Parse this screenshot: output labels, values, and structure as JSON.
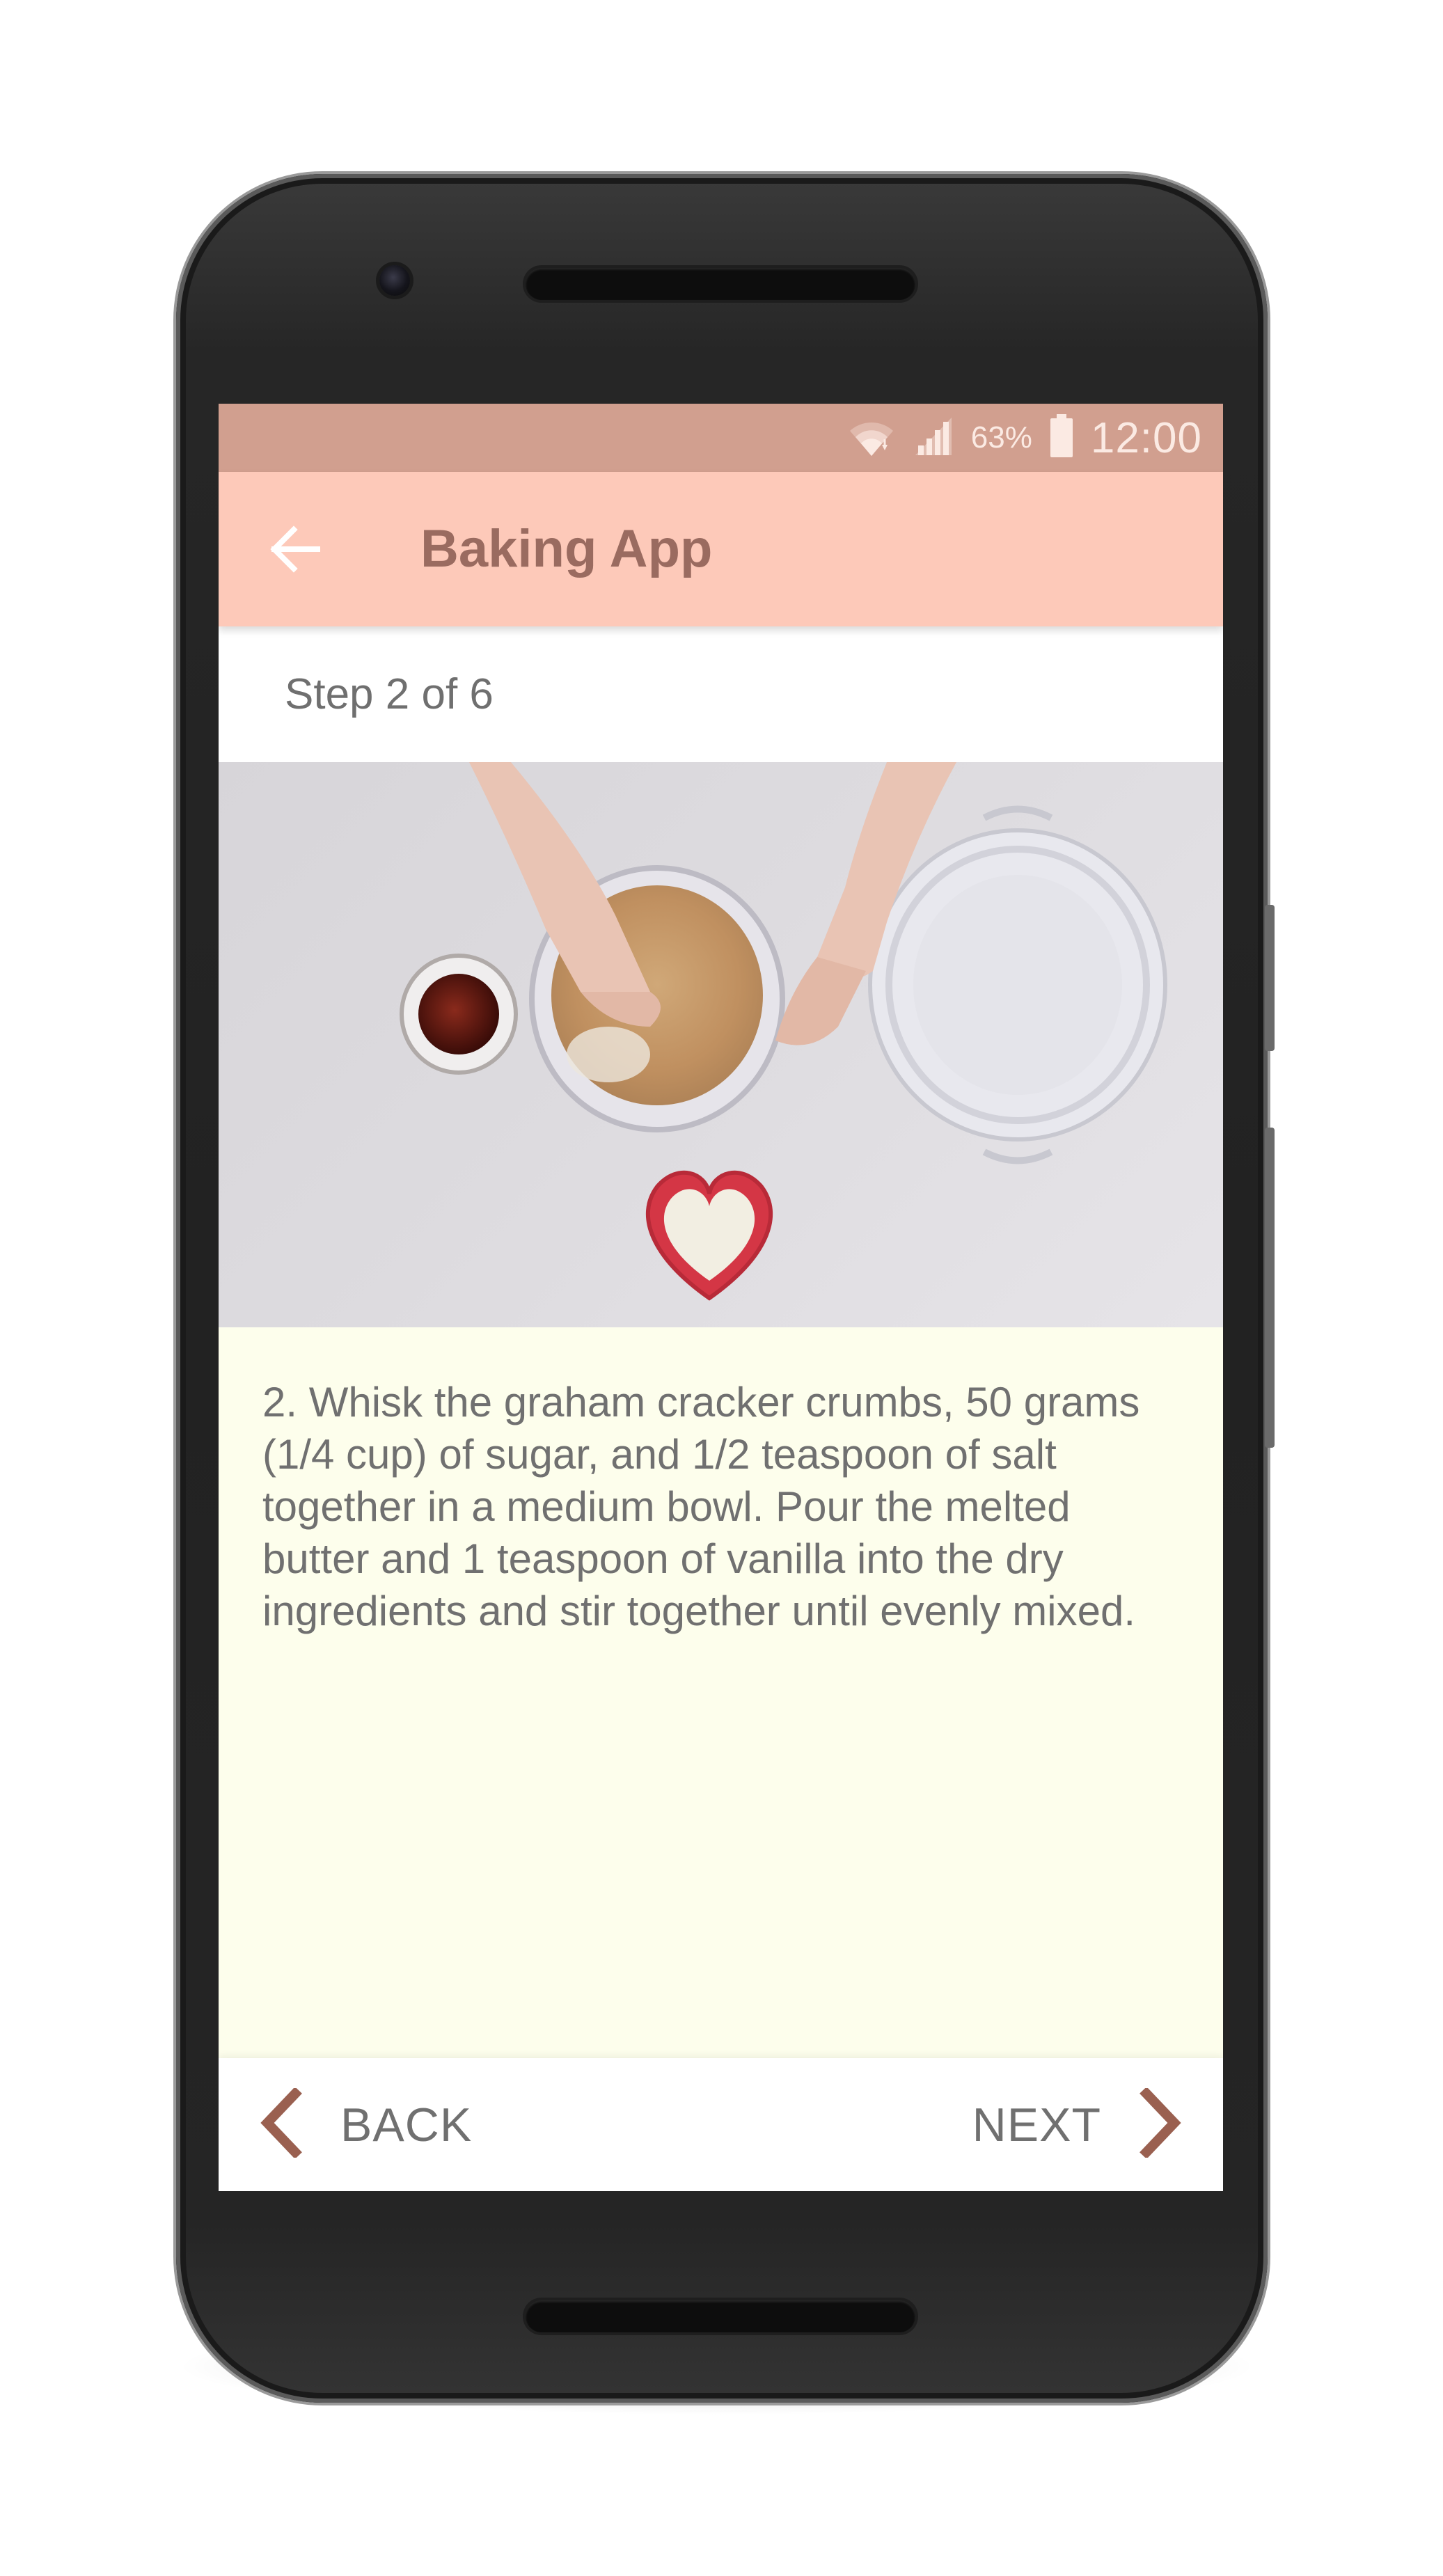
{
  "status_bar": {
    "battery_percent": "63%",
    "time": "12:00",
    "icons": [
      "wifi-icon",
      "cell-signal-icon",
      "battery-icon"
    ]
  },
  "app_bar": {
    "title": "Baking App",
    "back_icon": "arrow-back-icon"
  },
  "step": {
    "label": "Step 2 of 6",
    "description": "2. Whisk the graham cracker crumbs, 50 grams (1/4 cup) of sugar, and 1/2 teaspoon of salt together in a medium bowl. Pour the melted butter and 1 teaspoon of vanilla into the dry ingredients and stir together until evenly mixed."
  },
  "navigation": {
    "back_label": "BACK",
    "next_label": "NEXT",
    "back_icon": "chevron-left-icon",
    "next_icon": "chevron-right-icon"
  },
  "colors": {
    "status_bar": "#d19f8f",
    "app_bar": "#fdc9b9",
    "title_text": "#9a6b60",
    "description_bg": "#fdfeec",
    "chevron": "#9a6050"
  }
}
